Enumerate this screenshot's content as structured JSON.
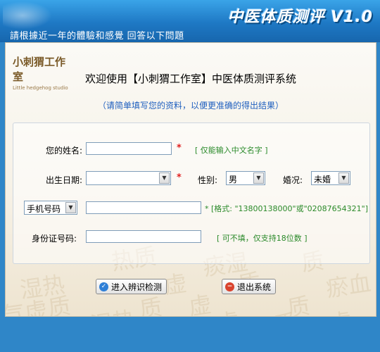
{
  "header": {
    "app_title": "中医体质测评 V1.0",
    "subtitle": "請根據近一年的體驗和感覺  回答以下問題"
  },
  "stamp": {
    "name": "小刺猬工作室",
    "english": "Little hedgehog studio"
  },
  "welcome": "欢迎使用【小刺猬工作室】中医体质测评系统",
  "hint": "（请简单填写您的资料，以便更准确的得出结果）",
  "form": {
    "name_label": "您的姓名:",
    "name_value": "",
    "name_required": "*",
    "name_note": "[ 仅能输入中文名字 ]",
    "birth_label": "出生日期:",
    "birth_value": "",
    "birth_required": "*",
    "gender_label": "性别:",
    "gender_value": "男",
    "marital_label": "婚况:",
    "marital_value": "未婚",
    "contact_type_value": "手机号码",
    "phone_value": "",
    "phone_note": "* [格式: \"13800138000\"或\"02087654321\"]",
    "id_label": "身份证号码:",
    "id_value": "",
    "id_note": "[ 可不填，仅支持18位数 ]"
  },
  "buttons": {
    "start": "进入辨识检测",
    "exit": "退出系统"
  },
  "watermark_words": [
    "热质",
    "痰湿",
    "质",
    "湿热",
    "虚",
    "质",
    "瘀血",
    "质",
    "虚",
    "气虚",
    "湿热",
    "质",
    "质",
    "虚",
    "质",
    "虚"
  ],
  "colors": {
    "header_blue": "#1e78c4",
    "required_red": "#e02020",
    "note_green": "#2a8a2a",
    "hint_blue": "#1f5fbf"
  }
}
